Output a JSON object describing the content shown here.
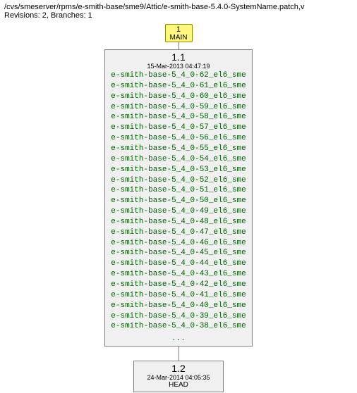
{
  "header": {
    "path": "/cvs/smeserver/rpms/e-smith-base/sme9/Attic/e-smith-base-5.4.0-SystemName.patch,v",
    "meta": "Revisions: 2, Branches: 1"
  },
  "main_tag": {
    "num": "1",
    "label": "MAIN"
  },
  "rev1": {
    "num": "1.1",
    "date": "15-Mar-2013 04:47:19",
    "tags": [
      "e-smith-base-5_4_0-62_el6_sme",
      "e-smith-base-5_4_0-61_el6_sme",
      "e-smith-base-5_4_0-60_el6_sme",
      "e-smith-base-5_4_0-59_el6_sme",
      "e-smith-base-5_4_0-58_el6_sme",
      "e-smith-base-5_4_0-57_el6_sme",
      "e-smith-base-5_4_0-56_el6_sme",
      "e-smith-base-5_4_0-55_el6_sme",
      "e-smith-base-5_4_0-54_el6_sme",
      "e-smith-base-5_4_0-53_el6_sme",
      "e-smith-base-5_4_0-52_el6_sme",
      "e-smith-base-5_4_0-51_el6_sme",
      "e-smith-base-5_4_0-50_el6_sme",
      "e-smith-base-5_4_0-49_el6_sme",
      "e-smith-base-5_4_0-48_el6_sme",
      "e-smith-base-5_4_0-47_el6_sme",
      "e-smith-base-5_4_0-46_el6_sme",
      "e-smith-base-5_4_0-45_el6_sme",
      "e-smith-base-5_4_0-44_el6_sme",
      "e-smith-base-5_4_0-43_el6_sme",
      "e-smith-base-5_4_0-42_el6_sme",
      "e-smith-base-5_4_0-41_el6_sme",
      "e-smith-base-5_4_0-40_el6_sme",
      "e-smith-base-5_4_0-39_el6_sme",
      "e-smith-base-5_4_0-38_el6_sme"
    ],
    "ellipsis": "..."
  },
  "rev2": {
    "num": "1.2",
    "date": "24-Mar-2014 04:05:35",
    "head": "HEAD"
  }
}
